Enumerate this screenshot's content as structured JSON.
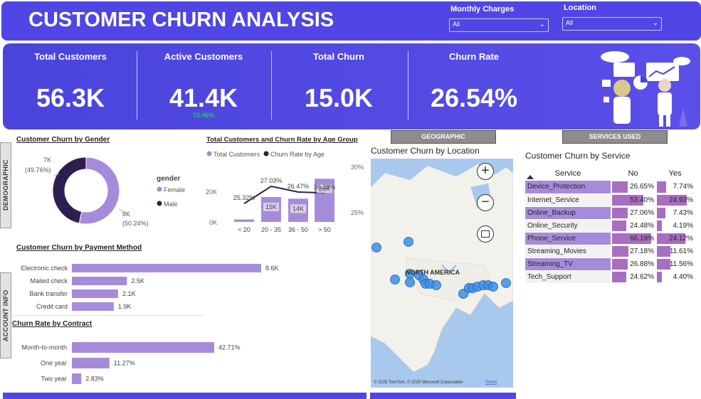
{
  "header": {
    "title": "CUSTOMER CHURN ANALYSIS",
    "filters": [
      {
        "label": "Monthly Charges",
        "value": "All"
      },
      {
        "label": "Location",
        "value": "All"
      }
    ]
  },
  "kpis": [
    {
      "label": "Total Customers",
      "value": "56.3K"
    },
    {
      "label": "Active Customers",
      "value": "41.4K",
      "sub": "73.46%"
    },
    {
      "label": "Total Churn",
      "value": "15.0K"
    },
    {
      "label": "Churn Rate",
      "value": "26.54%"
    }
  ],
  "section_tabs": {
    "demographic": "DEMOGRAPHIC",
    "account_info": "ACCOUNT INFO",
    "geographic": "GEOGRAPHIC",
    "services_used": "SERVICES USED"
  },
  "colors": {
    "primary": "#4f46e5",
    "light_purple": "#a78bdb",
    "dark_purple": "#2d1f4f",
    "green": "#22c55e"
  },
  "gender_chart": {
    "title": "Customer Churn by Gender",
    "legend_title": "gender",
    "chart_data": {
      "type": "pie",
      "categories": [
        "Female",
        "Male"
      ],
      "values": [
        8000,
        7000
      ],
      "value_labels": [
        "8K",
        "7K"
      ],
      "percent_labels": [
        "(50.24%)",
        "(49.76%)"
      ]
    }
  },
  "age_chart": {
    "title": "Total Customers and Churn Rate by Age Group",
    "chart_data": {
      "type": "bar",
      "categories": [
        "< 20",
        "20 - 35",
        "36 - 50",
        "> 50"
      ],
      "series": [
        {
          "name": "Total Customers",
          "values": [
            1500,
            15000,
            14000,
            26000
          ],
          "labels": [
            "",
            "15K",
            "14K",
            "26K"
          ]
        },
        {
          "name": "Churn Rate by Age",
          "values": [
            25.32,
            27.03,
            26.47,
            26.38
          ],
          "labels": [
            "25.32%",
            "27.03%",
            "26.47%",
            "26.38%"
          ]
        }
      ],
      "y_ticks": [
        "0K",
        "20K"
      ],
      "y2_ticks": [
        "25%",
        "30%"
      ],
      "ylim": [
        0,
        30000
      ],
      "y2lim": [
        23.5,
        30
      ]
    }
  },
  "payment_chart": {
    "title": "Customer Churn by Payment Method",
    "chart_data": {
      "type": "bar",
      "categories": [
        "Electronic check",
        "Mailed check",
        "Bank transfer",
        "Credit card"
      ],
      "values": [
        8600,
        2500,
        2100,
        1900
      ],
      "labels": [
        "8.6K",
        "2.5K",
        "2.1K",
        "1.9K"
      ]
    }
  },
  "contract_chart": {
    "title": "Churn Rate by Contract",
    "chart_data": {
      "type": "bar",
      "categories": [
        "Month-to-month",
        "One year",
        "Two year"
      ],
      "values": [
        42.71,
        11.27,
        2.83
      ],
      "labels": [
        "42.71%",
        "11.27%",
        "2.83%"
      ]
    }
  },
  "map": {
    "title": "Customer Churn by Location",
    "region_label": "NORTH AMERICA",
    "attribution": "© 2025 TomTom, © 2025 Microsoft Corporation",
    "terms": "Terms"
  },
  "service_table": {
    "title": "Customer Churn by Service",
    "headers": [
      "Service",
      "No",
      "Yes"
    ],
    "rows": [
      {
        "service": "Device_Protection",
        "no": "26.65%",
        "yes": "7.74%",
        "no_v": 26.65,
        "yes_v": 7.74,
        "hl": true
      },
      {
        "service": "Internet_Service",
        "no": "53.40%",
        "yes": "24.93%",
        "no_v": 53.4,
        "yes_v": 24.93,
        "hl": false
      },
      {
        "service": "Online_Backup",
        "no": "27.06%",
        "yes": "7.43%",
        "no_v": 27.06,
        "yes_v": 7.43,
        "hl": true
      },
      {
        "service": "Online_Security",
        "no": "24.48%",
        "yes": "4.19%",
        "no_v": 24.48,
        "yes_v": 4.19,
        "hl": false
      },
      {
        "service": "Phone_Service",
        "no": "66.19%",
        "yes": "24.12%",
        "no_v": 66.19,
        "yes_v": 24.12,
        "hl": true
      },
      {
        "service": "Streaming_Movies",
        "no": "27.18%",
        "yes": "11.61%",
        "no_v": 27.18,
        "yes_v": 11.61,
        "hl": false
      },
      {
        "service": "Streaming_TV",
        "no": "26.88%",
        "yes": "11.56%",
        "no_v": 26.88,
        "yes_v": 11.56,
        "hl": true
      },
      {
        "service": "Tech_Support",
        "no": "24.62%",
        "yes": "4.40%",
        "no_v": 24.62,
        "yes_v": 4.4,
        "hl": false
      }
    ]
  }
}
